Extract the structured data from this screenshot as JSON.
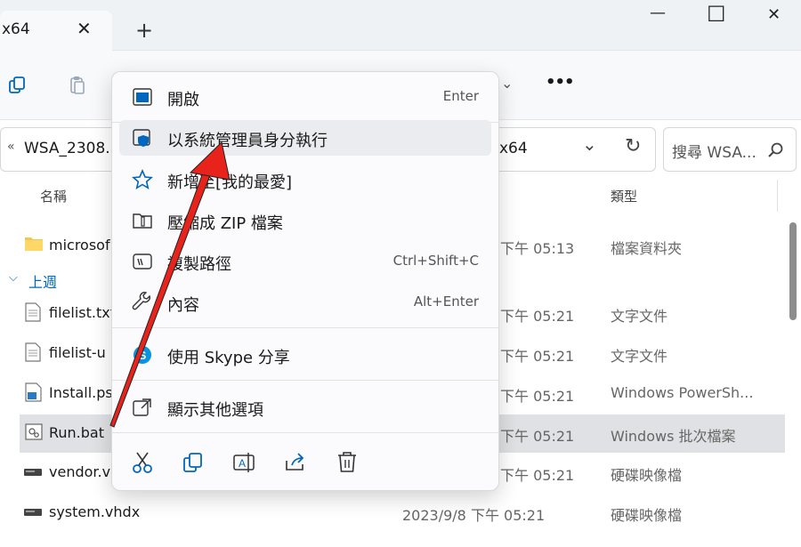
{
  "window": {
    "tab_title": "x64",
    "tab_close": "✕",
    "new_tab": "+",
    "minimize": "—",
    "maximize": "☐",
    "close": "✕"
  },
  "toolbar": {
    "more": "•••",
    "dropdown": "⌄"
  },
  "address": {
    "back_chevron": "«",
    "path_start": "WSA_2308.",
    "path_end": "x64",
    "chevron": "⌄",
    "refresh": "↻"
  },
  "search": {
    "placeholder": "搜尋 WSA..."
  },
  "columns": {
    "name": "名稱",
    "type": "類型"
  },
  "groups": {
    "last_week": "上週"
  },
  "files": [
    {
      "name": "microsof",
      "date": "下午 05:13",
      "type": "檔案資料夾"
    },
    {
      "name": "filelist.txt",
      "date": "下午 05:21",
      "type": "文字文件"
    },
    {
      "name": "filelist-u",
      "date": "下午 05:21",
      "type": "文字文件"
    },
    {
      "name": "Install.ps",
      "date": "下午 05:21",
      "type": "Windows PowerSh..."
    },
    {
      "name": "Run.bat",
      "date": "下午 05:21",
      "type": "Windows 批次檔案"
    },
    {
      "name": "vendor.v",
      "date": "下午 05:21",
      "type": "硬碟映像檔"
    },
    {
      "name": "system.vhdx",
      "date": "2023/9/8 下午 05:21",
      "type": "硬碟映像檔"
    }
  ],
  "menu": {
    "items": [
      {
        "label": "開啟",
        "shortcut": "Enter",
        "icon": "open-icon"
      },
      {
        "label": "以系統管理員身分執行",
        "shortcut": "",
        "icon": "shield-icon"
      },
      {
        "label": "新增至[我的最愛]",
        "shortcut": "",
        "icon": "star-icon"
      },
      {
        "label": "壓縮成 ZIP 檔案",
        "shortcut": "",
        "icon": "zip-icon"
      },
      {
        "label": "複製路徑",
        "shortcut": "Ctrl+Shift+C",
        "icon": "copy-path-icon"
      },
      {
        "label": "內容",
        "shortcut": "Alt+Enter",
        "icon": "wrench-icon"
      },
      {
        "label": "使用 Skype 分享",
        "shortcut": "",
        "icon": "skype-icon"
      },
      {
        "label": "顯示其他選項",
        "shortcut": "",
        "icon": "more-options-icon"
      }
    ]
  },
  "colors": {
    "accent": "#0067c0",
    "arrow": "#e8231b",
    "selection": "#dfe1e4"
  }
}
